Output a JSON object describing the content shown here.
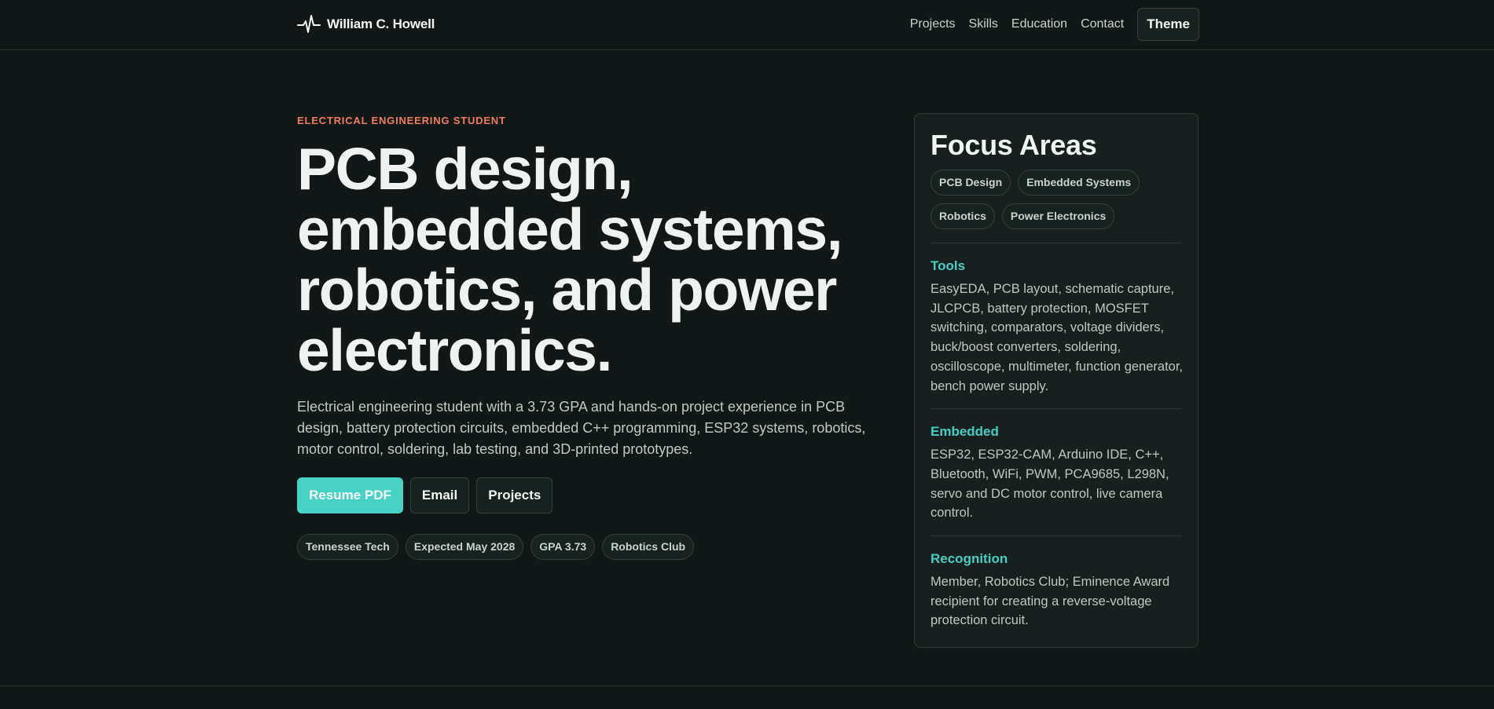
{
  "header": {
    "brand_name": "William C. Howell",
    "logo_icon": "pulse-waveform-icon",
    "nav": [
      "Projects",
      "Skills",
      "Education",
      "Contact"
    ],
    "theme_label": "Theme"
  },
  "hero": {
    "eyebrow": "ELECTRICAL ENGINEERING STUDENT",
    "headline": "PCB design, embedded systems, robotics, and power electronics.",
    "intro": "Electrical engineering student with a 3.73 GPA and hands-on project experience in PCB design, battery protection circuits, embedded C++ programming, ESP32 systems, robotics, motor control, soldering, lab testing, and 3D-printed prototypes.",
    "actions": [
      "Resume PDF",
      "Email",
      "Projects"
    ],
    "chips": [
      "Tennessee Tech",
      "Expected May 2028",
      "GPA 3.73",
      "Robotics Club"
    ]
  },
  "focus": {
    "title": "Focus Areas",
    "tags": [
      "PCB Design",
      "Embedded Systems",
      "Robotics",
      "Power Electronics"
    ],
    "sections": [
      {
        "title": "Tools",
        "body": "EasyEDA, PCB layout, schematic capture, JLCPCB, battery protection, MOSFET switching, comparators, voltage dividers, buck/boost converters, soldering, oscilloscope, multimeter, function generator, bench power supply."
      },
      {
        "title": "Embedded",
        "body": "ESP32, ESP32-CAM, Arduino IDE, C++, Bluetooth, WiFi, PWM, PCA9685, L298N, servo and DC motor control, live camera control."
      },
      {
        "title": "Recognition",
        "body": "Member, Robotics Club; Eminence Award recipient for creating a reverse-voltage protection circuit."
      }
    ]
  },
  "colors": {
    "background": "#111817",
    "accent_teal": "#48d2c6",
    "eyebrow_orange": "#f17c5c",
    "card_background": "#17201e"
  }
}
